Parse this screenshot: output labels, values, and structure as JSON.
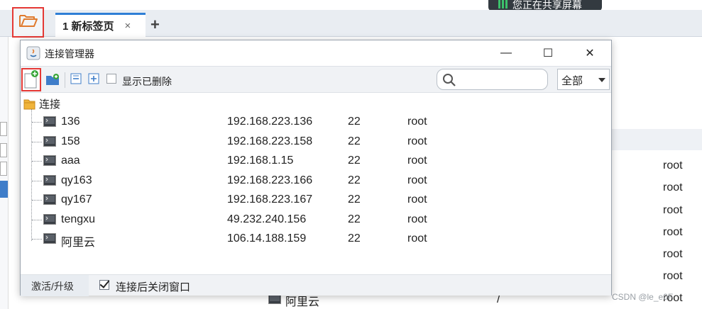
{
  "tabs": {
    "active_label": "1 新标签页",
    "close_glyph": "×",
    "add_glyph": "+"
  },
  "share_banner": {
    "text": "您正在共享屏幕"
  },
  "dialog": {
    "title": "连接管理器",
    "window_controls": {
      "minimize": "—",
      "maximize": "☐",
      "close": "✕"
    },
    "toolbar": {
      "show_deleted_label": "显示已删除",
      "search_placeholder": "",
      "filter_value": "全部"
    },
    "tree": {
      "root_label": "连接",
      "connections": [
        {
          "name": "136",
          "host": "192.168.223.136",
          "port": "22",
          "user": "root"
        },
        {
          "name": "158",
          "host": "192.168.223.158",
          "port": "22",
          "user": "root"
        },
        {
          "name": "aaa",
          "host": "192.168.1.15",
          "port": "22",
          "user": "root"
        },
        {
          "name": "qy163",
          "host": "192.168.223.166",
          "port": "22",
          "user": "root"
        },
        {
          "name": "qy167",
          "host": "192.168.223.167",
          "port": "22",
          "user": "root"
        },
        {
          "name": "tengxu",
          "host": "49.232.240.156",
          "port": "22",
          "user": "root"
        },
        {
          "name": "阿里云",
          "host": "106.14.188.159",
          "port": "22",
          "user": "root"
        }
      ]
    },
    "footer": {
      "activate_label": "激活/升级",
      "close_after_connect_label": "连接后关闭窗口"
    }
  },
  "background": {
    "right_users": [
      "root",
      "root",
      "root",
      "root",
      "root",
      "root",
      "root"
    ],
    "bottom_name": "阿里云",
    "bottom_slash": "/",
    "watermark": "CSDN @le_e0F"
  },
  "colors": {
    "accent_blue": "#2f7fd6",
    "highlight_red": "#e53935",
    "folder_orange": "#e07a2e"
  }
}
